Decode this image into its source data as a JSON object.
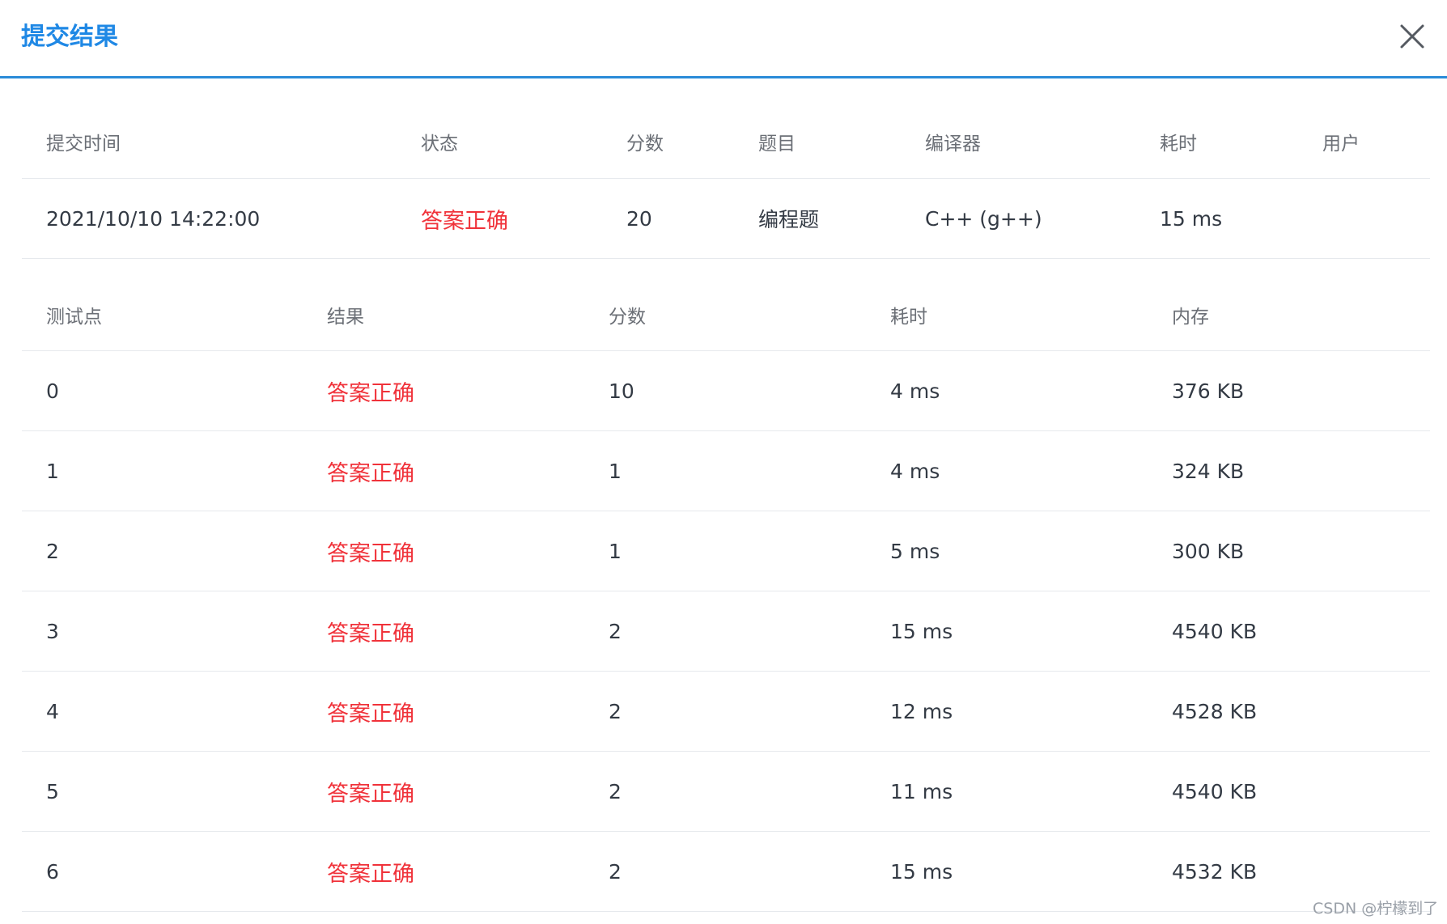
{
  "header": {
    "title": "提交结果"
  },
  "summary": {
    "columns": [
      "提交时间",
      "状态",
      "分数",
      "题目",
      "编译器",
      "耗时",
      "用户"
    ],
    "row": {
      "time": "2021/10/10 14:22:00",
      "status": "答案正确",
      "score": "20",
      "problem": "编程题",
      "compiler": "C++ (g++)",
      "elapsed": "15 ms",
      "user": ""
    }
  },
  "cases": {
    "columns": [
      "测试点",
      "结果",
      "分数",
      "耗时",
      "内存"
    ],
    "rows": [
      {
        "id": "0",
        "result": "答案正确",
        "score": "10",
        "time": "4 ms",
        "memory": "376 KB"
      },
      {
        "id": "1",
        "result": "答案正确",
        "score": "1",
        "time": "4 ms",
        "memory": "324 KB"
      },
      {
        "id": "2",
        "result": "答案正确",
        "score": "1",
        "time": "5 ms",
        "memory": "300 KB"
      },
      {
        "id": "3",
        "result": "答案正确",
        "score": "2",
        "time": "15 ms",
        "memory": "4540 KB"
      },
      {
        "id": "4",
        "result": "答案正确",
        "score": "2",
        "time": "12 ms",
        "memory": "4528 KB"
      },
      {
        "id": "5",
        "result": "答案正确",
        "score": "2",
        "time": "11 ms",
        "memory": "4540 KB"
      },
      {
        "id": "6",
        "result": "答案正确",
        "score": "2",
        "time": "15 ms",
        "memory": "4532 KB"
      }
    ]
  },
  "watermark": "CSDN @柠檬到了",
  "colors": {
    "accent": "#1f88e5",
    "success_text": "#f0323a"
  }
}
